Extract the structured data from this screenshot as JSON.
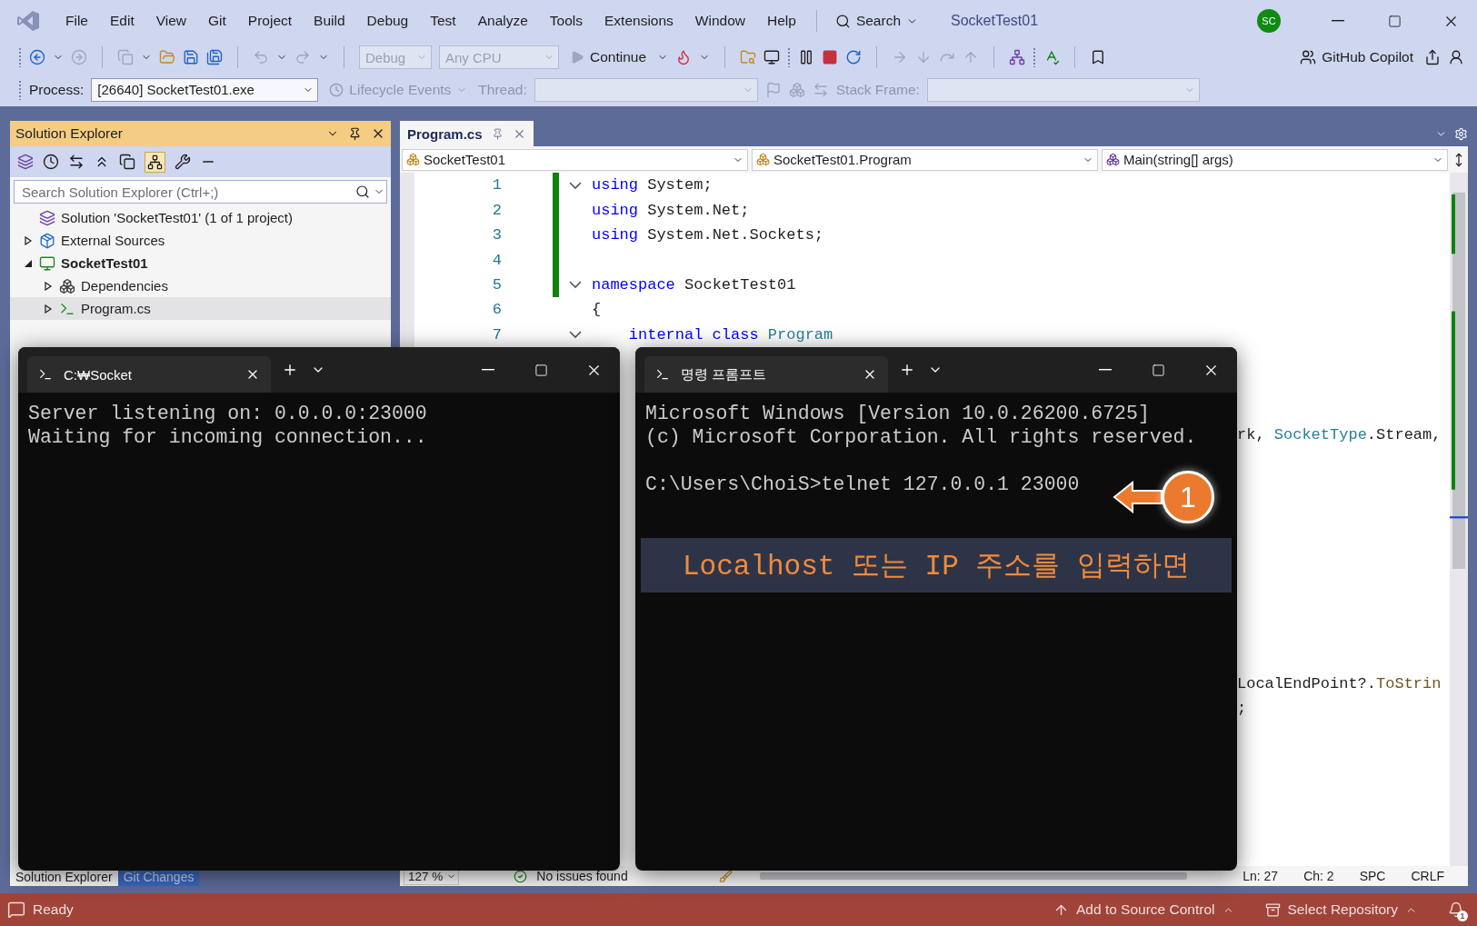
{
  "window": {
    "title": "SocketTest01",
    "avatar": "SC"
  },
  "menu": [
    {
      "label": "File"
    },
    {
      "label": "Edit"
    },
    {
      "label": "View"
    },
    {
      "label": "Git"
    },
    {
      "label": "Project"
    },
    {
      "label": "Build"
    },
    {
      "label": "Debug"
    },
    {
      "label": "Test"
    },
    {
      "label": "Analyze"
    },
    {
      "label": "Tools"
    },
    {
      "label": "Extensions"
    },
    {
      "label": "Window"
    },
    {
      "label": "Help"
    }
  ],
  "search": {
    "label": "Search"
  },
  "toolbar": {
    "configuration": {
      "value": "Debug",
      "disabled": true
    },
    "platform": {
      "value": "Any CPU",
      "disabled": true
    },
    "continue": "Continue",
    "copilot": "GitHub Copilot"
  },
  "debug_location": {
    "process_label": "Process:",
    "process": "[26640] SocketTest01.exe",
    "lifecycle": {
      "label": "Lifecycle Events",
      "disabled": true
    },
    "thread_label": "Thread:",
    "stack_frame_label": "Stack Frame:"
  },
  "solution_explorer": {
    "title": "Solution Explorer",
    "search": {
      "placeholder": "Search Solution Explorer (Ctrl+;)"
    },
    "tree": [
      {
        "label": "Solution 'SocketTest01' (1 of 1 project)",
        "kind": "solution",
        "selected": false
      },
      {
        "label": "External Sources",
        "kind": "external",
        "expanded": false,
        "selected": false
      },
      {
        "label": "SocketTest01",
        "kind": "project",
        "expanded": true,
        "selected": false,
        "children": [
          {
            "label": "Dependencies",
            "kind": "dependencies",
            "expanded": false,
            "selected": false
          },
          {
            "label": "Program.cs",
            "kind": "csharp",
            "expanded": false,
            "selected": true
          }
        ]
      }
    ],
    "tabs": [
      {
        "label": "Solution Explorer",
        "selected": true
      },
      {
        "label": "Git Changes",
        "selected": false
      }
    ]
  },
  "editor": {
    "tabs": [
      {
        "label": "Program.cs",
        "selected": true
      }
    ],
    "nav": [
      "SocketTest01",
      "SocketTest01.Program",
      "Main(string[] args)"
    ],
    "lines": [
      {
        "number": "1",
        "changed": true,
        "fold": true,
        "tokens": [
          {
            "t": "using",
            "kind": "keyword"
          },
          {
            "t": " System;",
            "kind": "plain"
          }
        ]
      },
      {
        "number": "2",
        "changed": true,
        "fold": false,
        "tokens": [
          {
            "t": "using",
            "kind": "keyword"
          },
          {
            "t": " System.Net;",
            "kind": "plain"
          }
        ]
      },
      {
        "number": "3",
        "changed": true,
        "fold": false,
        "tokens": [
          {
            "t": "using",
            "kind": "keyword"
          },
          {
            "t": " System.Net.Sockets;",
            "kind": "plain"
          }
        ]
      },
      {
        "number": "4",
        "changed": true,
        "fold": false
      },
      {
        "number": "5",
        "changed": true,
        "fold": true,
        "tokens": [
          {
            "t": "namespace",
            "kind": "keyword"
          },
          {
            "t": " SocketTest01",
            "kind": "plain"
          }
        ]
      },
      {
        "number": "6",
        "changed": false,
        "fold": false,
        "tokens": [
          {
            "t": "{",
            "kind": "plain"
          }
        ]
      },
      {
        "number": "7",
        "changed": false,
        "fold": true,
        "tokens": [
          {
            "t": "    internal class",
            "kind": "keyword"
          },
          {
            "t": " Program",
            "kind": "type"
          }
        ]
      }
    ],
    "fragments": [
      {
        "tokens": [
          {
            "t": "rk, ",
            "kind": "plain"
          },
          {
            "t": "SocketType",
            "kind": "type"
          },
          {
            "t": ".Stream,",
            "kind": "plain"
          }
        ]
      },
      {
        "tokens": [
          {
            "t": "LocalEndPoint?.",
            "kind": "plain"
          },
          {
            "t": "ToStrin",
            "kind": "method"
          }
        ]
      },
      {
        "tokens": [
          {
            "t": ";",
            "kind": "plain"
          }
        ]
      }
    ],
    "zoom": "127 %",
    "issues": "No issues found",
    "status": [
      "Ln: 27",
      "Ch: 2",
      "SPC",
      "CRLF"
    ]
  },
  "terminals": [
    {
      "tab": "C:₩Socket",
      "lines": [
        "Server listening on: 0.0.0.0:23000",
        "Waiting for incoming connection..."
      ]
    },
    {
      "tab": "명령 프롬프트",
      "lines": [
        "Microsoft Windows [Version 10.0.26200.6725]",
        "(c) Microsoft Corporation. All rights reserved."
      ],
      "prompt": "C:\\Users\\ChoiS>telnet 127.0.0.1 23000",
      "callout": {
        "number": "1"
      },
      "banner": "Localhost 또는 IP 주소를 입력하면"
    }
  ],
  "status_bar": {
    "text": "Ready",
    "source_control": "Add to Source Control",
    "repository": "Select Repository",
    "notifications": "1"
  }
}
